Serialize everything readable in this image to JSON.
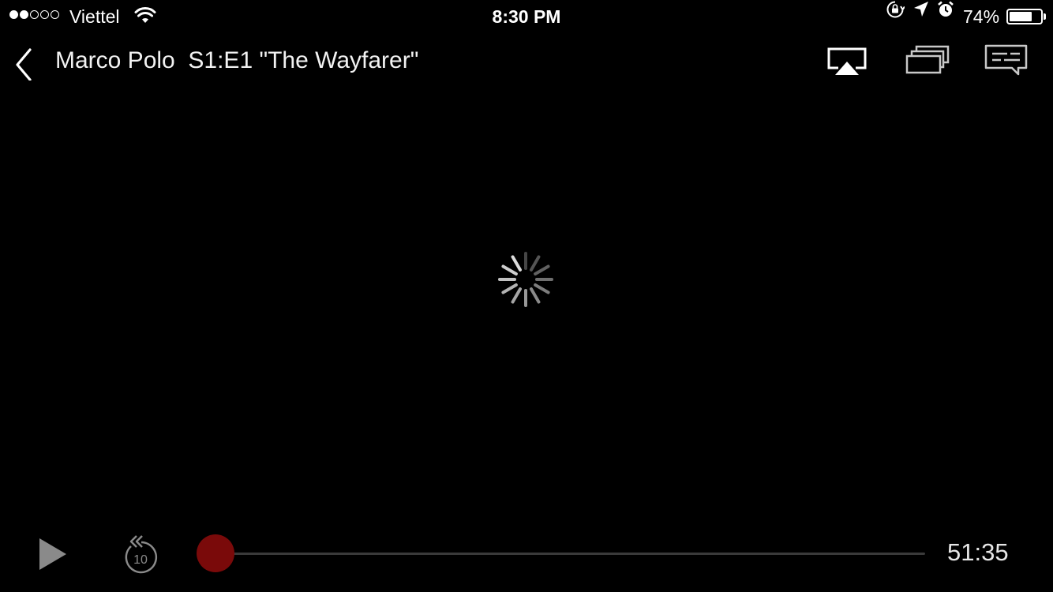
{
  "status_bar": {
    "signal_bars_filled": 2,
    "signal_bars_total": 5,
    "carrier": "Viettel",
    "time": "8:30 PM",
    "battery_percent_label": "74%",
    "battery_level": 0.74,
    "icons": [
      "wifi-icon",
      "orientation-lock-icon",
      "location-arrow-icon",
      "alarm-icon",
      "battery-icon"
    ]
  },
  "header": {
    "title": "Marco Polo  S1:E1 \"The Wayfarer\"",
    "icons": [
      "back-chevron-icon",
      "airplay-icon",
      "episodes-icon",
      "subtitles-icon"
    ]
  },
  "player": {
    "state": "loading",
    "playback_progress": 0,
    "duration": "51:35",
    "rewind_label": "10",
    "accent_color": "#b9090b",
    "thumb_color": "#7a0a0a"
  }
}
